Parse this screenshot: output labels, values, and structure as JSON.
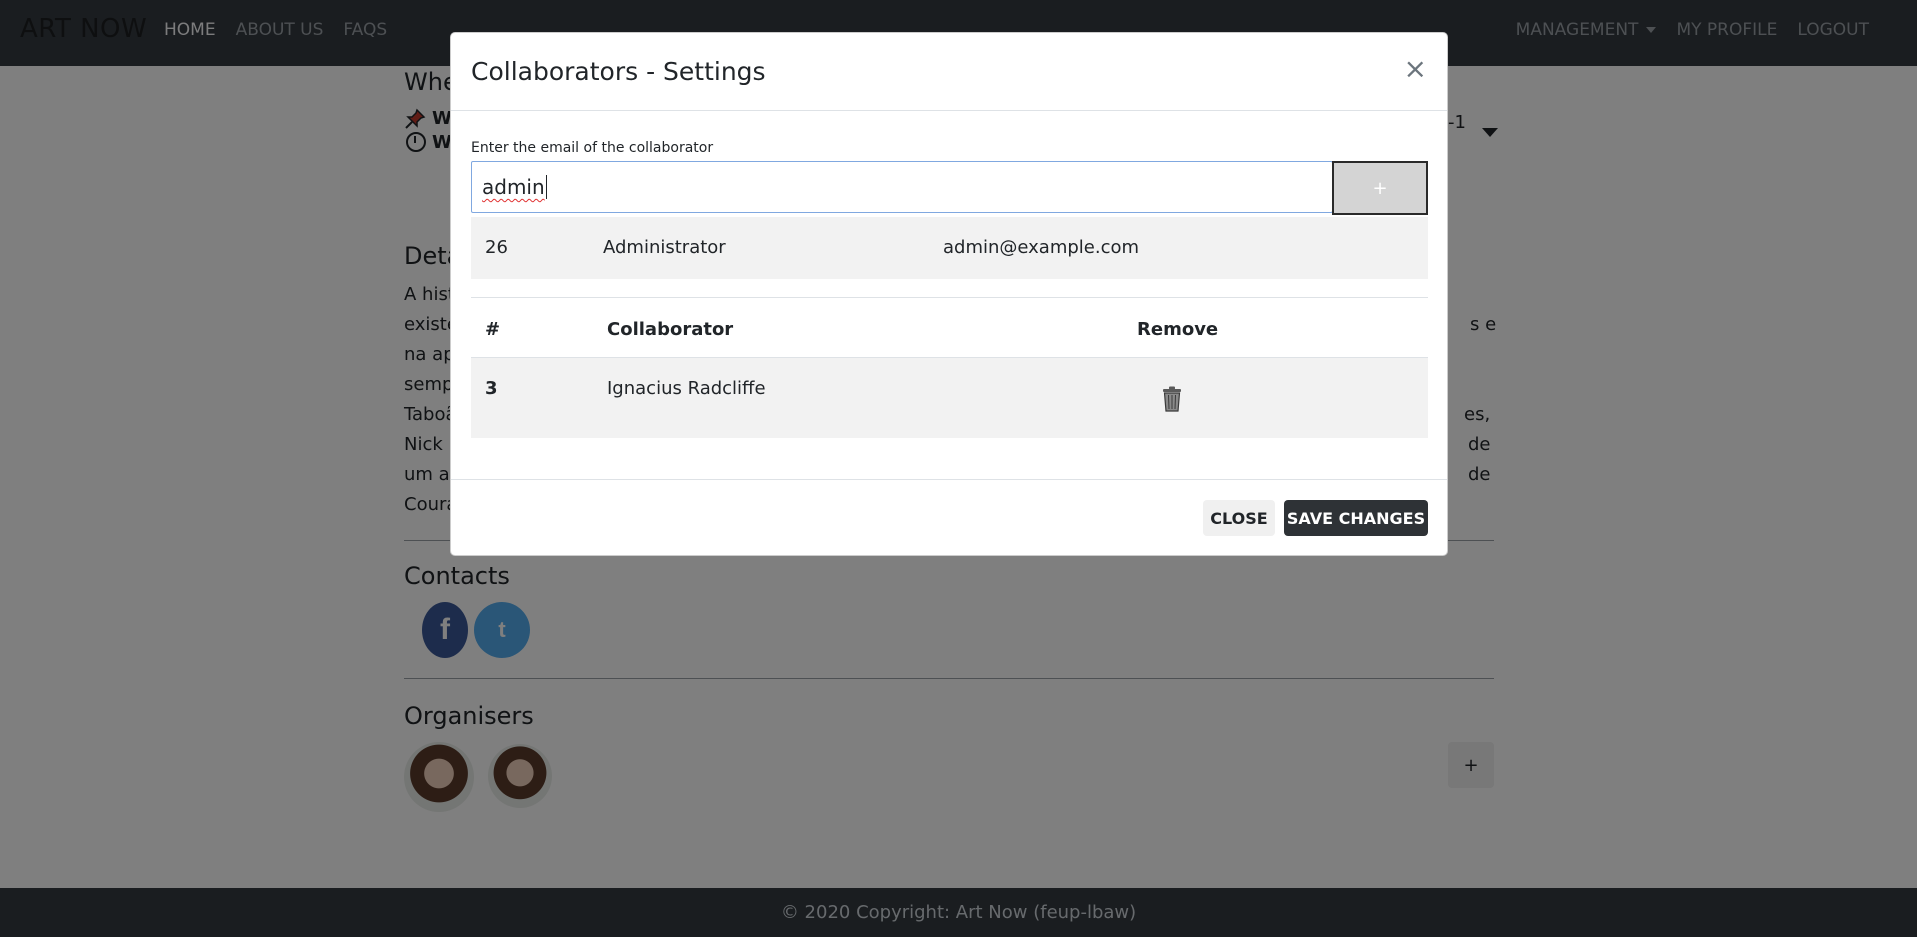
{
  "navbar": {
    "brand": "ART NOW",
    "left_links": [
      "HOME",
      "ABOUT US",
      "FAQS"
    ],
    "right_links": {
      "management": "MANAGEMENT",
      "profile": "MY PROFILE",
      "logout": "LOGOUT"
    }
  },
  "page": {
    "when_heading": "Whe",
    "when_line1": "W",
    "when_line2": "W",
    "when_right": "-1",
    "details_heading": "Deta",
    "details_lines_left": [
      "A hist",
      "existê",
      "na ap",
      "semp",
      "Taboã",
      "Nick",
      "um a",
      "Coura"
    ],
    "details_lines_right": [
      "s e",
      "es,",
      "de",
      "de"
    ],
    "contacts_heading": "Contacts",
    "facebook_glyph": "f",
    "twitter_glyph": "t",
    "organisers_heading": "Organisers",
    "add_organiser_label": "+"
  },
  "footer": {
    "text": "© 2020 Copyright: Art Now (feup-lbaw)"
  },
  "modal": {
    "title": "Collaborators - Settings",
    "close_symbol": "×",
    "email_label": "Enter the email of the collaborator",
    "email_value": "admin",
    "add_button_label": "+",
    "search_result": {
      "id": "26",
      "name": "Administrator",
      "email": "admin@example.com"
    },
    "table_headers": {
      "id": "#",
      "collaborator": "Collaborator",
      "remove": "Remove"
    },
    "collaborators": [
      {
        "id": "3",
        "name": "Ignacius Radcliffe"
      }
    ],
    "buttons": {
      "close": "CLOSE",
      "save": "SAVE CHANGES"
    }
  },
  "colors": {
    "navbar": "#343a40",
    "accent_dark": "#2e3236",
    "facebook": "#3b5998",
    "twitter": "#55acee",
    "input_focus": "#80a8e0"
  },
  "icons": [
    "pin-icon",
    "clock-icon",
    "facebook-icon",
    "twitter-icon",
    "trash-icon",
    "close-icon",
    "chevron-down-icon"
  ]
}
